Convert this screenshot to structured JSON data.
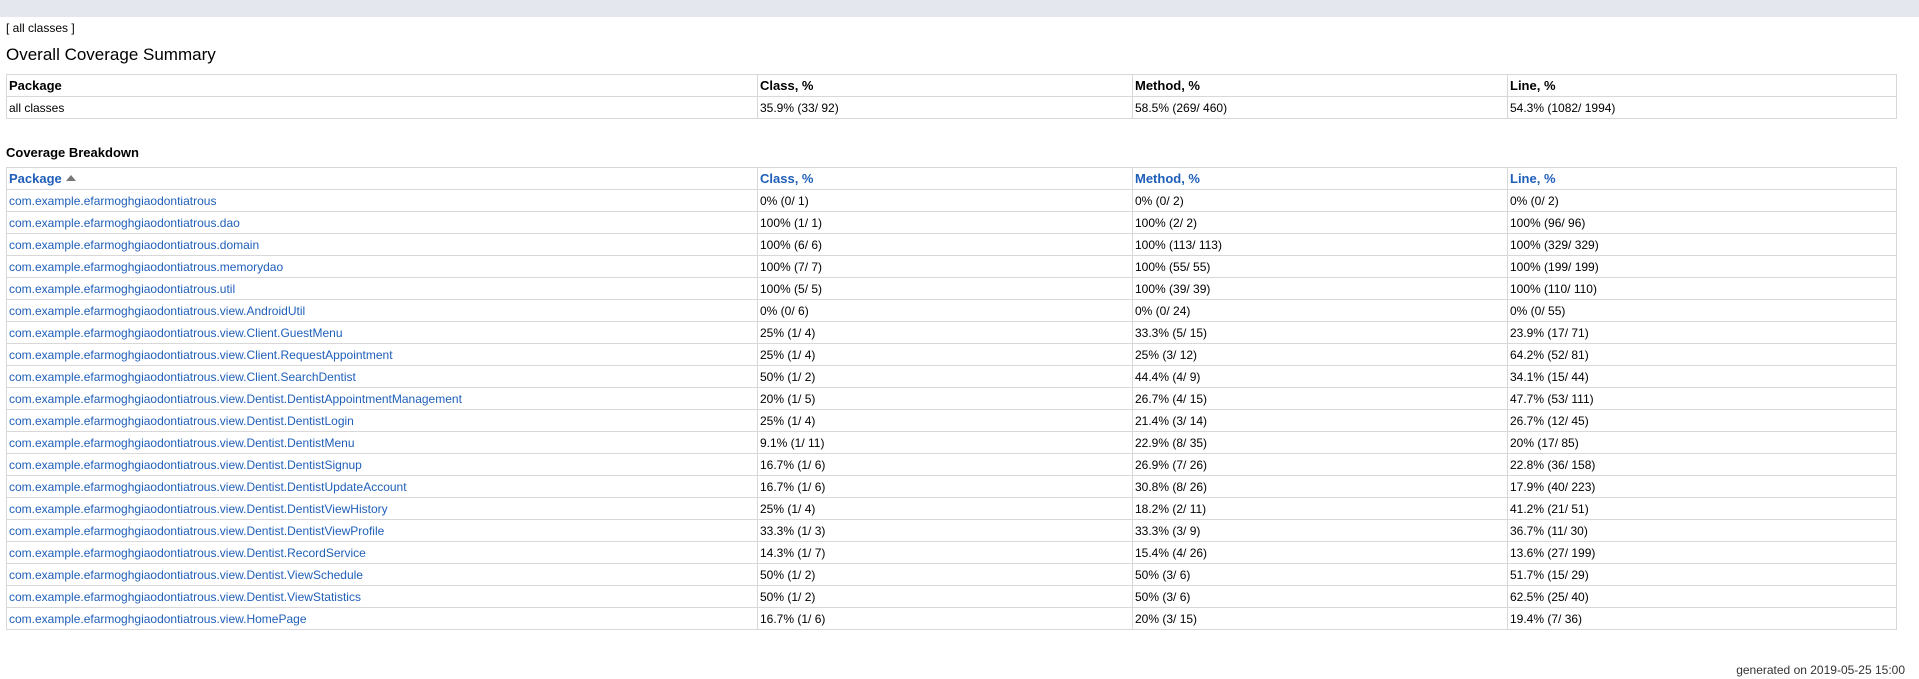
{
  "header": {
    "breadcrumb_text": "[ all classes ]"
  },
  "summary": {
    "title": "Overall Coverage Summary",
    "columns": [
      "Package",
      "Class, %",
      "Method, %",
      "Line, %"
    ],
    "row": [
      "all classes",
      "35.9% (33/ 92)",
      "58.5% (269/ 460)",
      "54.3% (1082/ 1994)"
    ]
  },
  "breakdown": {
    "title": "Coverage Breakdown",
    "columns": [
      "Package",
      "Class, %",
      "Method, %",
      "Line, %"
    ],
    "rows": [
      [
        "com.example.efarmoghgiaodontiatrous",
        "0% (0/ 1)",
        "0% (0/ 2)",
        "0% (0/ 2)"
      ],
      [
        "com.example.efarmoghgiaodontiatrous.dao",
        "100% (1/ 1)",
        "100% (2/ 2)",
        "100% (96/ 96)"
      ],
      [
        "com.example.efarmoghgiaodontiatrous.domain",
        "100% (6/ 6)",
        "100% (113/ 113)",
        "100% (329/ 329)"
      ],
      [
        "com.example.efarmoghgiaodontiatrous.memorydao",
        "100% (7/ 7)",
        "100% (55/ 55)",
        "100% (199/ 199)"
      ],
      [
        "com.example.efarmoghgiaodontiatrous.util",
        "100% (5/ 5)",
        "100% (39/ 39)",
        "100% (110/ 110)"
      ],
      [
        "com.example.efarmoghgiaodontiatrous.view.AndroidUtil",
        "0% (0/ 6)",
        "0% (0/ 24)",
        "0% (0/ 55)"
      ],
      [
        "com.example.efarmoghgiaodontiatrous.view.Client.GuestMenu",
        "25% (1/ 4)",
        "33.3% (5/ 15)",
        "23.9% (17/ 71)"
      ],
      [
        "com.example.efarmoghgiaodontiatrous.view.Client.RequestAppointment",
        "25% (1/ 4)",
        "25% (3/ 12)",
        "64.2% (52/ 81)"
      ],
      [
        "com.example.efarmoghgiaodontiatrous.view.Client.SearchDentist",
        "50% (1/ 2)",
        "44.4% (4/ 9)",
        "34.1% (15/ 44)"
      ],
      [
        "com.example.efarmoghgiaodontiatrous.view.Dentist.DentistAppointmentManagement",
        "20% (1/ 5)",
        "26.7% (4/ 15)",
        "47.7% (53/ 111)"
      ],
      [
        "com.example.efarmoghgiaodontiatrous.view.Dentist.DentistLogin",
        "25% (1/ 4)",
        "21.4% (3/ 14)",
        "26.7% (12/ 45)"
      ],
      [
        "com.example.efarmoghgiaodontiatrous.view.Dentist.DentistMenu",
        "9.1% (1/ 11)",
        "22.9% (8/ 35)",
        "20% (17/ 85)"
      ],
      [
        "com.example.efarmoghgiaodontiatrous.view.Dentist.DentistSignup",
        "16.7% (1/ 6)",
        "26.9% (7/ 26)",
        "22.8% (36/ 158)"
      ],
      [
        "com.example.efarmoghgiaodontiatrous.view.Dentist.DentistUpdateAccount",
        "16.7% (1/ 6)",
        "30.8% (8/ 26)",
        "17.9% (40/ 223)"
      ],
      [
        "com.example.efarmoghgiaodontiatrous.view.Dentist.DentistViewHistory",
        "25% (1/ 4)",
        "18.2% (2/ 11)",
        "41.2% (21/ 51)"
      ],
      [
        "com.example.efarmoghgiaodontiatrous.view.Dentist.DentistViewProfile",
        "33.3% (1/ 3)",
        "33.3% (3/ 9)",
        "36.7% (11/ 30)"
      ],
      [
        "com.example.efarmoghgiaodontiatrous.view.Dentist.RecordService",
        "14.3% (1/ 7)",
        "15.4% (4/ 26)",
        "13.6% (27/ 199)"
      ],
      [
        "com.example.efarmoghgiaodontiatrous.view.Dentist.ViewSchedule",
        "50% (1/ 2)",
        "50% (3/ 6)",
        "51.7% (15/ 29)"
      ],
      [
        "com.example.efarmoghgiaodontiatrous.view.Dentist.ViewStatistics",
        "50% (1/ 2)",
        "50% (3/ 6)",
        "62.5% (25/ 40)"
      ],
      [
        "com.example.efarmoghgiaodontiatrous.view.HomePage",
        "16.7% (1/ 6)",
        "20% (3/ 15)",
        "19.4% (7/ 36)"
      ]
    ]
  },
  "footer": {
    "generated": "generated on 2019-05-25 15:00"
  },
  "colors": {
    "link": "#1f5fb9",
    "topbar": "#e4e8ee",
    "border": "#d8d8d8"
  },
  "icons": {
    "sort": "sort-ascending-icon"
  }
}
